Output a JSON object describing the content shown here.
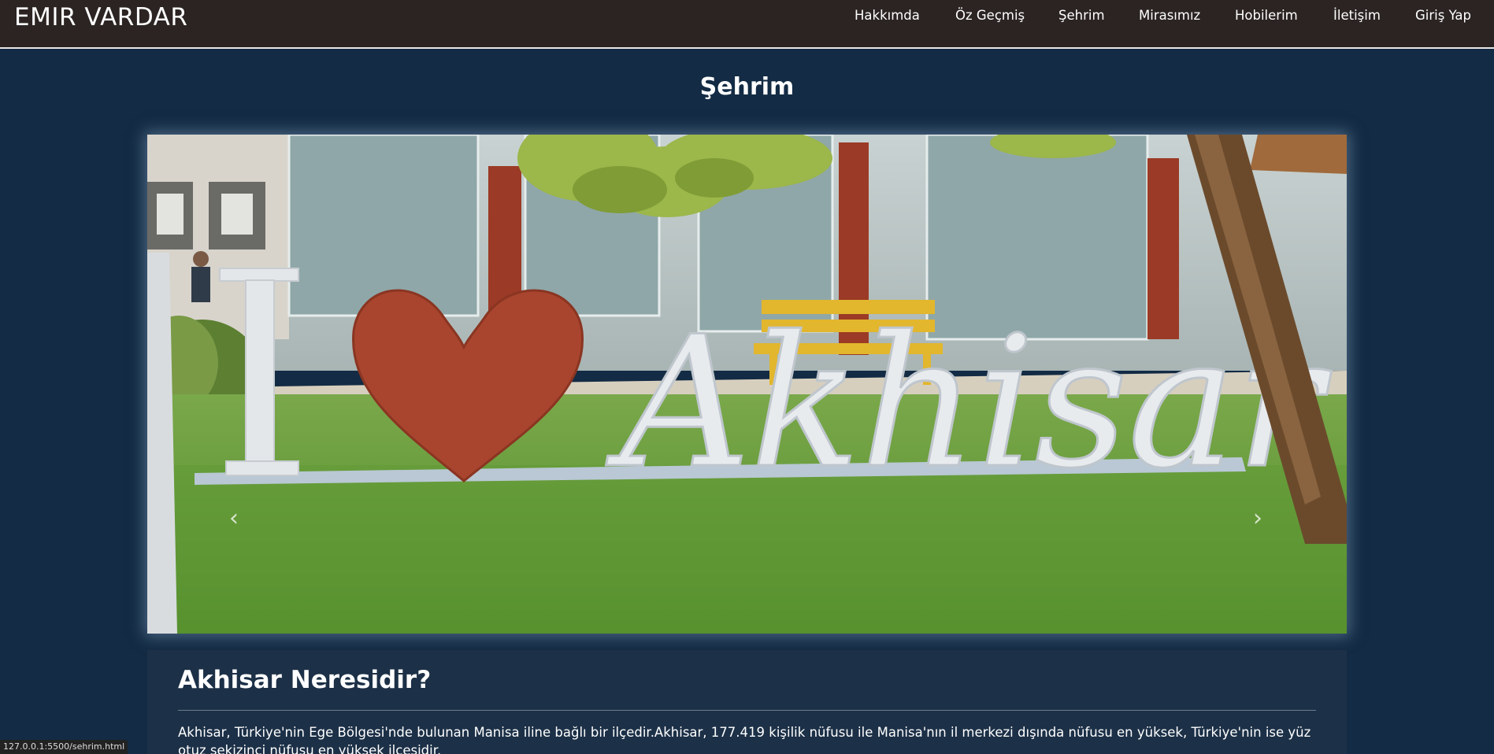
{
  "navbar": {
    "brand": "EMIR VARDAR",
    "links": [
      {
        "label": "Hakkımda"
      },
      {
        "label": "Öz Geçmiş"
      },
      {
        "label": "Şehrim"
      },
      {
        "label": "Mirasımız"
      },
      {
        "label": "Hobilerim"
      },
      {
        "label": "İletişim"
      },
      {
        "label": "Giriş Yap"
      }
    ]
  },
  "page": {
    "title": "Şehrim"
  },
  "carousel": {
    "prev_icon": "chevron-left-icon",
    "next_icon": "chevron-right-icon",
    "sign_letter": "I",
    "sign_word": "Akhisar"
  },
  "article": {
    "title": "Akhisar Neresidir?",
    "text": "Akhisar, Türkiye'nin Ege Bölgesi'nde bulunan Manisa iline bağlı bir ilçedir.Akhisar, 177.419 kişilik nüfusu ile Manisa'nın il merkezi dışında nüfusu en yüksek, Türkiye'nin ise yüz otuz sekizinci nüfusu en yüksek ilçesidir."
  },
  "status_bar": {
    "url": "127.0.0.1:5500/sehrim.html"
  },
  "colors": {
    "navbar_bg": "#2b2423",
    "page_bg": "#132b44",
    "article_bg": "#1c3047"
  }
}
